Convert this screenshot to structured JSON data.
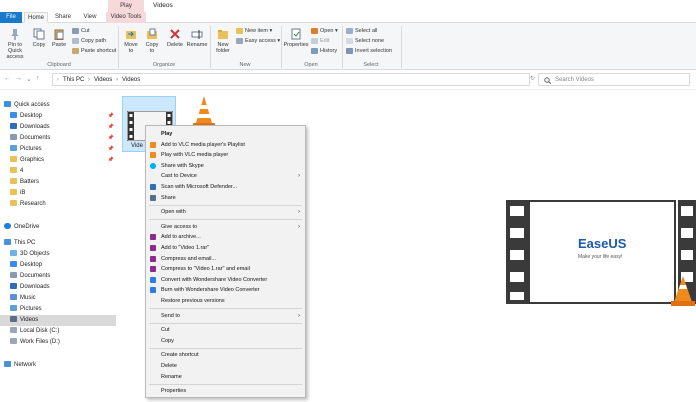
{
  "window": {
    "title": "Videos",
    "contextual_tab_header": "Play"
  },
  "tabs": [
    "File",
    "Home",
    "Share",
    "View",
    "Video Tools"
  ],
  "ribbon": {
    "clipboard": {
      "pin": "Pin to Quick access",
      "copy": "Copy",
      "paste": "Paste",
      "cut": "Cut",
      "copy_path": "Copy path",
      "paste_shortcut": "Paste shortcut",
      "label": "Clipboard"
    },
    "organize": {
      "move_to": "Move to",
      "copy_to": "Copy to",
      "delete": "Delete",
      "rename": "Rename",
      "label": "Organize"
    },
    "new": {
      "new_folder": "New folder",
      "new_item": "New item",
      "easy_access": "Easy access",
      "label": "New"
    },
    "open": {
      "properties": "Properties",
      "open": "Open",
      "edit": "Edit",
      "history": "History",
      "label": "Open"
    },
    "select": {
      "select_all": "Select all",
      "select_none": "Select none",
      "invert": "Invert selection",
      "label": "Select"
    }
  },
  "address": {
    "segments": [
      "This PC",
      "Videos",
      "Videos"
    ],
    "search_placeholder": "Search Videos"
  },
  "nav": {
    "quick_access": "Quick access",
    "qa_items": [
      "Desktop",
      "Downloads",
      "Documents",
      "Pictures",
      "Graphics",
      "4",
      "Batters",
      "iB",
      "Research"
    ],
    "onedrive": "OneDrive",
    "this_pc": "This PC",
    "pc_items": [
      "3D Objects",
      "Desktop",
      "Documents",
      "Downloads",
      "Music",
      "Pictures",
      "Videos",
      "Local Disk (C:)",
      "Work Files (D:)"
    ],
    "network": "Network"
  },
  "files": {
    "selected_name": "Vide"
  },
  "context_menu": {
    "items": [
      {
        "label": "Play",
        "bold": true
      },
      {
        "label": "Add to VLC media player's Playlist",
        "icon": "vlc-cone-icon"
      },
      {
        "label": "Play with VLC media player",
        "icon": "vlc-cone-icon"
      },
      {
        "label": "Share with Skype",
        "icon": "skype-icon"
      },
      {
        "label": "Cast to Device",
        "submenu": true
      },
      {
        "label": "Scan with Microsoft Defender...",
        "icon": "defender-icon"
      },
      {
        "label": "Share",
        "icon": "share-icon"
      },
      {
        "label": "Open with",
        "submenu": true,
        "sep_before": true
      },
      {
        "label": "Give access to",
        "submenu": true,
        "sep_before": true
      },
      {
        "label": "Add to archive...",
        "icon": "winrar-icon"
      },
      {
        "label": "Add to \"Video 1.rar\"",
        "icon": "winrar-icon"
      },
      {
        "label": "Compress and email...",
        "icon": "winrar-icon"
      },
      {
        "label": "Compress to \"Video 1.rar\" and email",
        "icon": "winrar-icon"
      },
      {
        "label": "Convert with Wondershare Video Converter",
        "icon": "wondershare-icon"
      },
      {
        "label": "Burn with Wondershare Video Converter",
        "icon": "wondershare-icon"
      },
      {
        "label": "Restore previous versions"
      },
      {
        "label": "Send to",
        "submenu": true,
        "sep_before": true
      },
      {
        "label": "Cut",
        "sep_before": true
      },
      {
        "label": "Copy"
      },
      {
        "label": "Create shortcut",
        "sep_before": true
      },
      {
        "label": "Delete"
      },
      {
        "label": "Rename"
      },
      {
        "label": "Properties",
        "sep_before": true
      }
    ]
  },
  "easeus": {
    "brand": "EaseUS",
    "tagline": "Make your life easy!"
  },
  "colors": {
    "file_tab": "#1979ca",
    "video_tools_tab": "#f7d9dc",
    "selection": "#cce8ff",
    "folder": "#e8c15a"
  }
}
